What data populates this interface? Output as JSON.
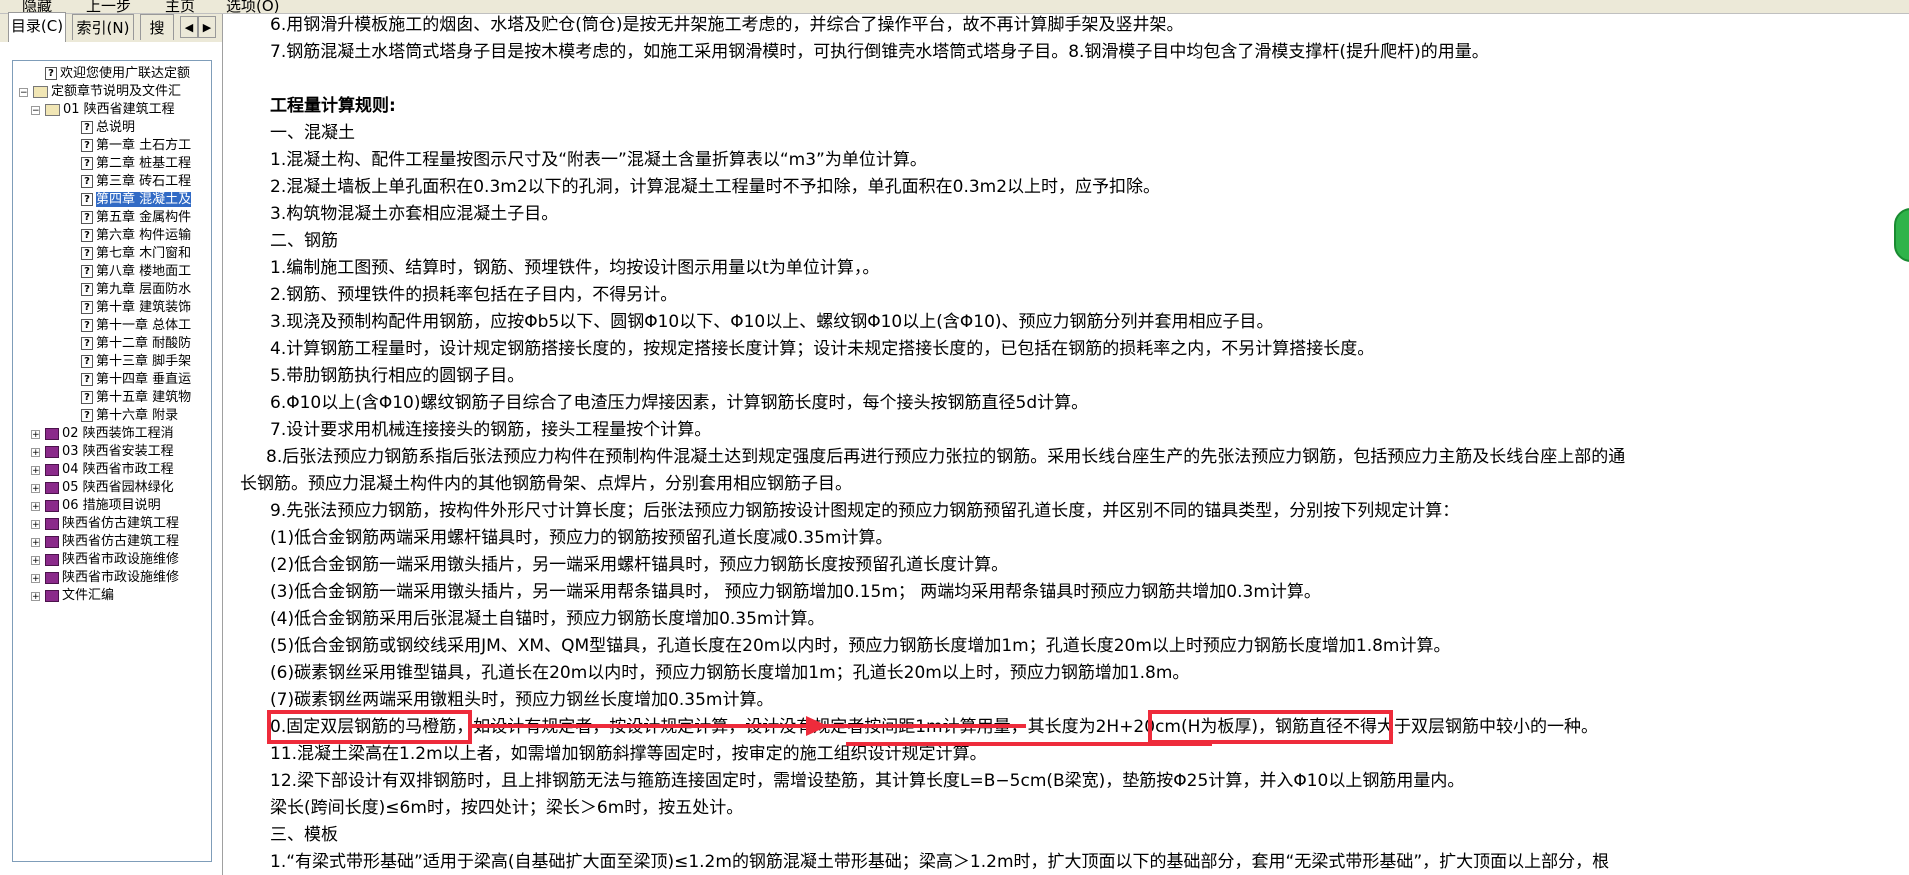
{
  "toolbar": {
    "buttons": [
      "隐藏",
      "上一步",
      "主页",
      "选项(O)"
    ]
  },
  "sidebar": {
    "tabs": [
      "目录(C)",
      "索引(N)",
      "搜"
    ],
    "tab_prev": "◀",
    "tab_next": "▶",
    "tree": [
      {
        "label": "欢迎您使用广联达定额",
        "icon": "help-page-icon",
        "level": 1
      },
      {
        "label": "定额章节说明及文件汇",
        "icon": "open-book-icon",
        "level": 0,
        "expander": "−"
      },
      {
        "label": "01 陕西省建筑工程",
        "icon": "open-book-icon",
        "level": 1,
        "expander": "−"
      },
      {
        "label": "总说明",
        "icon": "help-page-icon",
        "level": 2
      },
      {
        "label": "第一章 土石方工",
        "icon": "help-page-icon",
        "level": 2
      },
      {
        "label": "第二章 桩基工程",
        "icon": "help-page-icon",
        "level": 2
      },
      {
        "label": "第三章 砖石工程",
        "icon": "help-page-icon",
        "level": 2
      },
      {
        "label": "第四章 混凝土及",
        "icon": "help-page-icon",
        "level": 2,
        "selected": true
      },
      {
        "label": "第五章 金属构件",
        "icon": "help-page-icon",
        "level": 2
      },
      {
        "label": "第六章 构件运输",
        "icon": "help-page-icon",
        "level": 2
      },
      {
        "label": "第七章 木门窗和",
        "icon": "help-page-icon",
        "level": 2
      },
      {
        "label": "第八章 楼地面工",
        "icon": "help-page-icon",
        "level": 2
      },
      {
        "label": "第九章 层面防水",
        "icon": "help-page-icon",
        "level": 2
      },
      {
        "label": "第十章 建筑装饰",
        "icon": "help-page-icon",
        "level": 2
      },
      {
        "label": "第十一章 总体工",
        "icon": "help-page-icon",
        "level": 2
      },
      {
        "label": "第十二章 耐酸防",
        "icon": "help-page-icon",
        "level": 2
      },
      {
        "label": "第十三章 脚手架",
        "icon": "help-page-icon",
        "level": 2
      },
      {
        "label": "第十四章 垂直运",
        "icon": "help-page-icon",
        "level": 2
      },
      {
        "label": "第十五章 建筑物",
        "icon": "help-page-icon",
        "level": 2
      },
      {
        "label": "第十六章 附录",
        "icon": "help-page-icon",
        "level": 2
      },
      {
        "label": "02 陕西装饰工程消",
        "icon": "book-icon",
        "level": 1,
        "expander": "+"
      },
      {
        "label": "03 陕西省安装工程",
        "icon": "book-icon",
        "level": 1,
        "expander": "+"
      },
      {
        "label": "04 陕西省市政工程",
        "icon": "book-icon",
        "level": 1,
        "expander": "+"
      },
      {
        "label": "05 陕西省园林绿化",
        "icon": "book-icon",
        "level": 1,
        "expander": "+"
      },
      {
        "label": "06 措施项目说明",
        "icon": "book-icon",
        "level": 1,
        "expander": "+"
      },
      {
        "label": "陕西省仿古建筑工程",
        "icon": "book-icon",
        "level": 1,
        "expander": "+"
      },
      {
        "label": "陕西省仿古建筑工程",
        "icon": "book-icon",
        "level": 1,
        "expander": "+"
      },
      {
        "label": "陕西省市政设施维修",
        "icon": "book-icon",
        "level": 1,
        "expander": "+"
      },
      {
        "label": "陕西省市政设施维修",
        "icon": "book-icon",
        "level": 1,
        "expander": "+"
      },
      {
        "label": "文件汇编",
        "icon": "book-icon",
        "level": 1,
        "expander": "+"
      }
    ]
  },
  "content": {
    "lines": [
      "6.用钢滑升模板施工的烟囱、水塔及贮仓(筒仓)是按无井架施工考虑的，并综合了操作平台，故不再计算脚手架及竖井架。",
      "7.钢筋混凝土水塔筒式塔身子目是按木模考虑的，如施工采用钢滑模时，可执行倒锥壳水塔筒式塔身子目。8.钢滑模子目中均包含了滑模支撑杆(提升爬杆)的用量。",
      "",
      "工程量计算规则:",
      "一、混凝土",
      "1.混凝土构、配件工程量按图示尺寸及“附表一”混凝土含量折算表以“m3”为单位计算。",
      "2.混凝土墙板上单孔面积在0.3m2以下的孔洞，计算混凝土工程量时不予扣除，单孔面积在0.3m2以上时，应予扣除。",
      "3.构筑物混凝土亦套相应混凝土子目。",
      "二、钢筋",
      "1.编制施工图预、结算时，钢筋、预埋铁件，均按设计图示用量以t为单位计算，。",
      "2.钢筋、预埋铁件的损耗率包括在子目内，不得另计。",
      "3.现浇及预制构配件用钢筋，应按Φb5以下、圆钢Φ10以下、Φ10以上、螺纹钢Φ10以上(含Φ10)、预应力钢筋分列并套用相应子目。",
      "4.计算钢筋工程量时，设计规定钢筋搭接长度的，按规定搭接长度计算；设计未规定搭接长度的，已包括在钢筋的损耗率之内，不另计算搭接长度。",
      "5.带肋钢筋执行相应的圆钢子目。",
      "6.Φ10以上(含Φ10)螺纹钢筋子目综合了电渣压力焊接因素，计算钢筋长度时，每个接头按钢筋直径5d计算。",
      "7.设计要求用机械连接接头的钢筋，接头工程量按个计算。",
      "8.后张法预应力钢筋系指后张法预应力构件在预制构件混凝土达到规定强度后再进行预应力张拉的钢筋。采用长线台座生产的先张法预应力钢筋，包括预应力主筋及长线台座上部的通",
      "长钢筋。预应力混凝土构件内的其他钢筋骨架、点焊片，分别套用相应钢筋子目。",
      "9.先张法预应力钢筋，按构件外形尺寸计算长度；后张法预应力钢筋按设计图规定的预应力钢筋预留孔道长度，并区别不同的锚具类型，分别按下列规定计算：",
      "(1)低合金钢筋两端采用螺杆锚具时，预应力的钢筋按预留孔道长度减0.35m计算。",
      "(2)低合金钢筋一端采用镦头插片，另一端采用螺杆锚具时，预应力钢筋长度按预留孔道长度计算。",
      "(3)低合金钢筋一端采用镦头插片，另一端采用帮条锚具时， 预应力钢筋增加0.15m； 两端均采用帮条锚具时预应力钢筋共增加0.3m计算。",
      "(4)低合金钢筋采用后张混凝土自锚时，预应力钢筋长度增加0.35m计算。",
      "(5)低合金钢筋或钢绞线采用JM、XM、QM型锚具，孔道长度在20m以内时，预应力钢筋长度增加1m；孔道长度20m以上时预应力钢筋长度增加1.8m计算。",
      "(6)碳素钢丝采用锥型锚具，孔道长在20m以内时，预应力钢筋长度增加1m；孔道长20m以上时，预应力钢筋增加1.8m。",
      "(7)碳素钢丝两端采用镦粗头时，预应力钢丝长度增加0.35m计算。",
      "0.固定双层钢筋的马橙筋，如设计有规定者，按设计规定计算，设计没有规定者按间距1m计算用量，其长度为2H+20cm(H为板厚)，钢筋直径不得大于双层钢筋中较小的一种。",
      "11.混凝土梁高在1.2m以上者，如需增加钢筋斜撑等固定时，按审定的施工组织设计规定计算。",
      "12.梁下部设计有双排钢筋时，且上排钢筋无法与箍筋连接固定时，需增设垫筋，其计算长度L=B−5cm(B梁宽)，垫筋按Φ25计算，并入Φ10以上钢筋用量内。",
      "梁长(跨间长度)≤6m时，按四处计；梁长＞6m时，按五处计。",
      "三、模板",
      "1.“有梁式带形基础”适用于梁高(自基础扩大面至梁顶)≤1.2m的钢筋混凝土带形基础；梁高＞1.2m时，扩大顶面以下的基础部分，套用“无梁式带形基础”，扩大顶面以上部分，根"
    ]
  },
  "colors": {
    "annotation": "#ee2b3b",
    "selection": "#316ac5"
  }
}
